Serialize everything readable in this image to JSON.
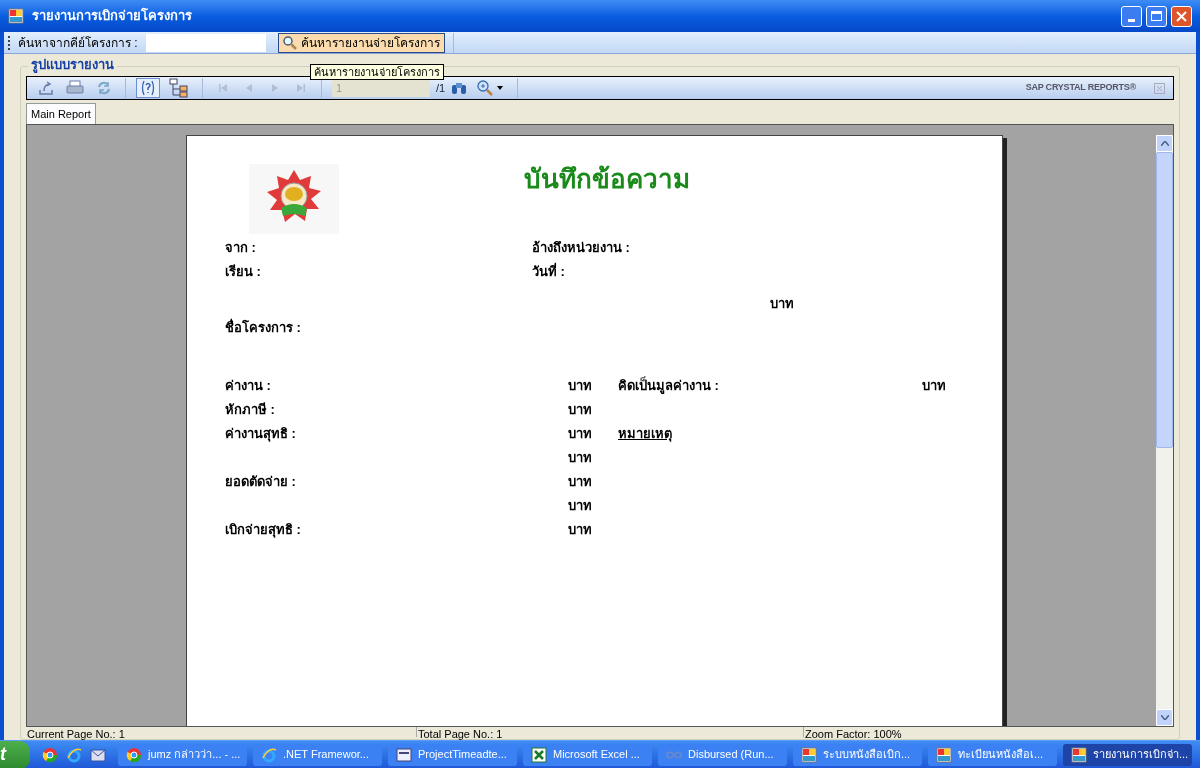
{
  "window": {
    "title": "รายงานการเบิกจ่ายโครงการ"
  },
  "search_bar": {
    "label": "ค้นหาจากคีย์โครงการ :",
    "button": "ค้นหารายงานจ่ายโครงการ",
    "tooltip": "ค้นหารายงานจ่ายโครงการ"
  },
  "group_title": "รูปแบบรายงาน",
  "viewer_toolbar": {
    "buttons": [
      {
        "kind": "export",
        "selected": false,
        "disabled": false
      },
      {
        "kind": "print",
        "selected": false,
        "disabled": false
      },
      {
        "kind": "refresh",
        "selected": false,
        "disabled": false
      },
      {
        "kind": "help",
        "selected": true,
        "disabled": false
      },
      {
        "kind": "tree",
        "selected": false,
        "disabled": false
      },
      {
        "kind": "first",
        "selected": false,
        "disabled": true
      },
      {
        "kind": "prev",
        "selected": false,
        "disabled": true
      },
      {
        "kind": "next",
        "selected": false,
        "disabled": true
      },
      {
        "kind": "last",
        "selected": false,
        "disabled": true
      }
    ],
    "page_value": "1",
    "page_total": "/1",
    "brand": "SAP CRYSTAL REPORTS®"
  },
  "tabs": [
    {
      "label": "Main Report",
      "selected": true
    }
  ],
  "report": {
    "title": "บันทึกข้อความ",
    "header_rows": [
      {
        "left": "จาก :",
        "right": "อ้างถึงหน่วยงาน :"
      },
      {
        "left": "เรียน :",
        "right": "วันที่ :"
      }
    ],
    "baht": "บาท",
    "project_label": "ชื่อโครงการ :",
    "amount_rows": [
      {
        "label": "ค่างาน :",
        "unit": "บาท",
        "remark": {
          "kind": "field",
          "text": "คิดเป็นมูลค่างาน :",
          "unit": "บาท"
        }
      },
      {
        "label": "หักภาษี :",
        "unit": "บาท"
      },
      {
        "label": "ค่างานสุทธิ :",
        "unit": "บาท",
        "remark": {
          "kind": "heading",
          "text": "หมายเหตุ"
        }
      },
      {
        "unit": "บาท"
      },
      {
        "label": "ยอดตัดจ่าย :",
        "unit": "บาท"
      },
      {
        "unit": "บาท"
      },
      {
        "label": "เบิกจ่ายสุทธิ :",
        "unit": "บาท"
      }
    ]
  },
  "status_bar": [
    "Current Page No.: 1",
    "Total Page No.: 1",
    "Zoom Factor: 100%"
  ],
  "taskbar": {
    "start": "t",
    "quick_launch": [
      {
        "kind": "chrome"
      },
      {
        "kind": "ie"
      },
      {
        "kind": "outlook"
      }
    ],
    "tasks": [
      {
        "label": "jumz กล่าวว่า... - ...",
        "kind": "chrome",
        "selected": false
      },
      {
        "label": ".NET Framewor...",
        "kind": "ie",
        "selected": false
      },
      {
        "label": "ProjectTimeadte...",
        "kind": "vs",
        "selected": false
      },
      {
        "label": "Microsoft Excel ...",
        "kind": "excel",
        "selected": false
      },
      {
        "label": "Disbursed (Run...",
        "kind": "vsrun",
        "selected": false
      },
      {
        "label": "ระบบหนังสือเบิก...",
        "kind": "app",
        "selected": false
      },
      {
        "label": "ทะเบียนหนังสือเ...",
        "kind": "app",
        "selected": false
      },
      {
        "label": "รายงานการเบิกจ่า...",
        "kind": "app",
        "selected": true
      }
    ]
  }
}
